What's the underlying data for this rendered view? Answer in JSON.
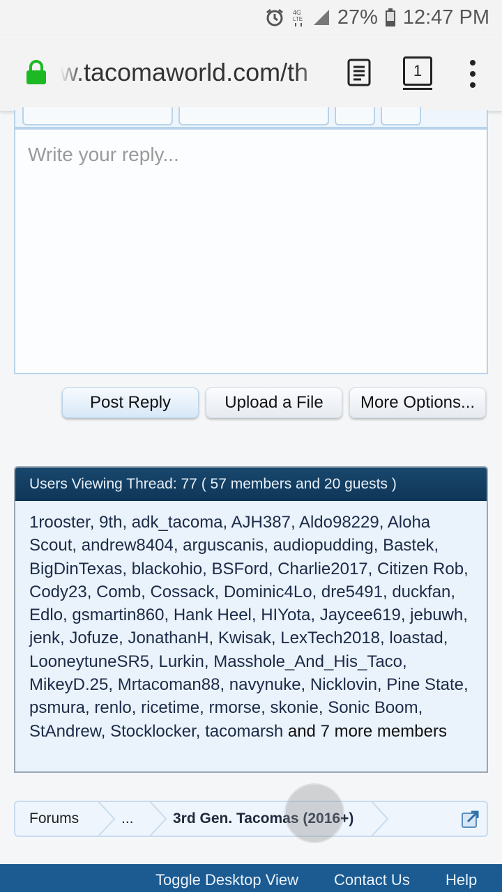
{
  "status_bar": {
    "icons": [
      "alarm-icon",
      "lte-data-icon",
      "signal-icon",
      "battery-icon"
    ],
    "network_label": "4G LTE",
    "battery": "27%",
    "time": "12:47 PM"
  },
  "browser": {
    "url": "w.tacomaworld.com/th",
    "tab_count": "1",
    "icons": [
      "lock-icon",
      "reader-mode-icon",
      "tab-switcher-icon",
      "overflow-menu-icon"
    ]
  },
  "editor": {
    "placeholder": "Write your reply..."
  },
  "actions": {
    "post_reply": "Post Reply",
    "upload_file": "Upload a File",
    "more_options": "More Options..."
  },
  "users_viewing": {
    "title": "Users Viewing Thread: 77 ( 57 members and 20 guests )",
    "members": [
      "1rooster",
      "9th",
      "adk_tacoma",
      "AJH387",
      "Aldo98229",
      "Aloha Scout",
      "andrew8404",
      "arguscanis",
      "audiopudding",
      "Bastek",
      "BigDinTexas",
      "blackohio",
      "BSFord",
      "Charlie2017",
      "Citizen Rob",
      "Cody23",
      "Comb",
      "Cossack",
      "Dominic4Lo",
      "dre5491",
      "duckfan",
      "Edlo",
      "gsmartin860",
      "Hank Heel",
      "HIYota",
      "Jaycee619",
      "jebuwh",
      "jenk",
      "Jofuze",
      "JonathanH",
      "Kwisak",
      "LexTech2018",
      "loastad",
      "LooneytuneSR5",
      "Lurkin",
      "Masshole_And_His_Taco",
      "MikeyD.25",
      "Mrtacoman88",
      "navynuke",
      "Nicklovin",
      "Pine State",
      "psmura",
      "renlo",
      "ricetime",
      "rmorse",
      "skonie",
      "Sonic Boom",
      "StAndrew",
      "Stocklocker",
      "tacomarsh"
    ],
    "more_text": " and 7 more members"
  },
  "breadcrumb": {
    "items": [
      "Forums",
      "...",
      "3rd Gen. Tacomas (2016+)"
    ],
    "jump_icon": "jump-to-icon"
  },
  "footer": {
    "toggle_desktop": "Toggle Desktop View",
    "contact_us": "Contact Us",
    "help": "Help"
  },
  "colors": {
    "header_blue": "#0f3658",
    "footer_blue": "#1b5b92",
    "box_background": "#eaf2fb",
    "secure_green": "#1db924"
  }
}
